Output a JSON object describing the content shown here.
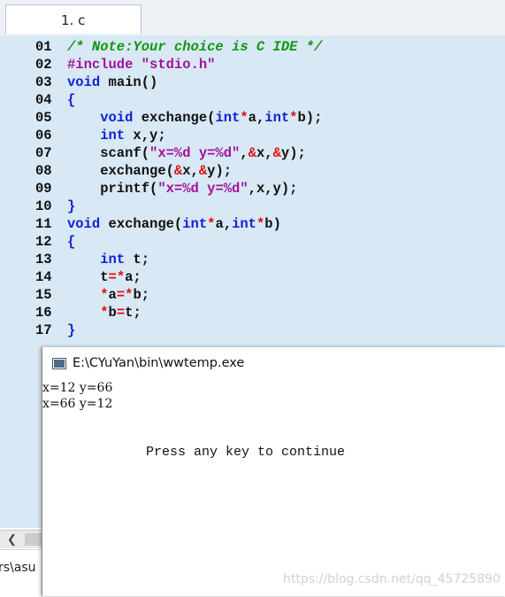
{
  "tab": {
    "label": "1. c"
  },
  "editor": {
    "lines": [
      {
        "num": "01",
        "tokens": [
          {
            "t": "/* Note:Your choice is C IDE */",
            "c": "cmt"
          }
        ]
      },
      {
        "num": "02",
        "tokens": [
          {
            "t": "#include ",
            "c": "pp"
          },
          {
            "t": "\"stdio.h\"",
            "c": "str"
          }
        ]
      },
      {
        "num": "03",
        "tokens": [
          {
            "t": "void",
            "c": "kw"
          },
          {
            "t": " main()",
            "c": "id"
          }
        ]
      },
      {
        "num": "04",
        "tokens": [
          {
            "t": "{",
            "c": "kw"
          }
        ]
      },
      {
        "num": "05",
        "tokens": [
          {
            "t": "    void",
            "c": "kw"
          },
          {
            "t": " exchange(",
            "c": "id"
          },
          {
            "t": "int",
            "c": "kw"
          },
          {
            "t": "*",
            "c": "op"
          },
          {
            "t": "a,",
            "c": "id"
          },
          {
            "t": "int",
            "c": "kw"
          },
          {
            "t": "*",
            "c": "op"
          },
          {
            "t": "b);",
            "c": "id"
          }
        ]
      },
      {
        "num": "06",
        "tokens": [
          {
            "t": "    int",
            "c": "kw"
          },
          {
            "t": " x,y;",
            "c": "id"
          }
        ]
      },
      {
        "num": "07",
        "tokens": [
          {
            "t": "    scanf(",
            "c": "id"
          },
          {
            "t": "\"x=%d y=%d\"",
            "c": "str"
          },
          {
            "t": ",",
            "c": "id"
          },
          {
            "t": "&",
            "c": "op"
          },
          {
            "t": "x,",
            "c": "id"
          },
          {
            "t": "&",
            "c": "op"
          },
          {
            "t": "y);",
            "c": "id"
          }
        ]
      },
      {
        "num": "08",
        "tokens": [
          {
            "t": "    exchange(",
            "c": "id"
          },
          {
            "t": "&",
            "c": "op"
          },
          {
            "t": "x,",
            "c": "id"
          },
          {
            "t": "&",
            "c": "op"
          },
          {
            "t": "y);",
            "c": "id"
          }
        ]
      },
      {
        "num": "09",
        "tokens": [
          {
            "t": "    printf(",
            "c": "id"
          },
          {
            "t": "\"x=%d y=%d\"",
            "c": "str"
          },
          {
            "t": ",x,y);",
            "c": "id"
          }
        ]
      },
      {
        "num": "10",
        "tokens": [
          {
            "t": "}",
            "c": "kw"
          }
        ]
      },
      {
        "num": "11",
        "tokens": [
          {
            "t": "void",
            "c": "kw"
          },
          {
            "t": " exchange(",
            "c": "id"
          },
          {
            "t": "int",
            "c": "kw"
          },
          {
            "t": "*",
            "c": "op"
          },
          {
            "t": "a,",
            "c": "id"
          },
          {
            "t": "int",
            "c": "kw"
          },
          {
            "t": "*",
            "c": "op"
          },
          {
            "t": "b)",
            "c": "id"
          }
        ]
      },
      {
        "num": "12",
        "tokens": [
          {
            "t": "{",
            "c": "kw"
          }
        ]
      },
      {
        "num": "13",
        "tokens": [
          {
            "t": "    int",
            "c": "kw"
          },
          {
            "t": " t;",
            "c": "id"
          }
        ]
      },
      {
        "num": "14",
        "tokens": [
          {
            "t": "    t",
            "c": "id"
          },
          {
            "t": "=*",
            "c": "op"
          },
          {
            "t": "a;",
            "c": "id"
          }
        ]
      },
      {
        "num": "15",
        "tokens": [
          {
            "t": "    ",
            "c": "id"
          },
          {
            "t": "*",
            "c": "op"
          },
          {
            "t": "a",
            "c": "id"
          },
          {
            "t": "=*",
            "c": "op"
          },
          {
            "t": "b;",
            "c": "id"
          }
        ]
      },
      {
        "num": "16",
        "tokens": [
          {
            "t": "    ",
            "c": "id"
          },
          {
            "t": "*",
            "c": "op"
          },
          {
            "t": "b",
            "c": "id"
          },
          {
            "t": "=",
            "c": "op"
          },
          {
            "t": "t;",
            "c": "id"
          }
        ]
      },
      {
        "num": "17",
        "tokens": [
          {
            "t": "}",
            "c": "kw"
          }
        ]
      }
    ]
  },
  "bottom": {
    "text": "rs\\asu"
  },
  "console": {
    "title": "E:\\CYuYan\\bin\\wwtemp.exe",
    "output": [
      "x=12 y=66",
      "x=66 y=12"
    ],
    "press": "Press any key to continue"
  },
  "watermark": "https://blog.csdn.net/qq_45725890",
  "colors": {
    "editor_bg": "#d8e8f4",
    "keyword": "#1020d8",
    "string": "#a0129a",
    "comment": "#119611",
    "operator": "#e01010"
  }
}
